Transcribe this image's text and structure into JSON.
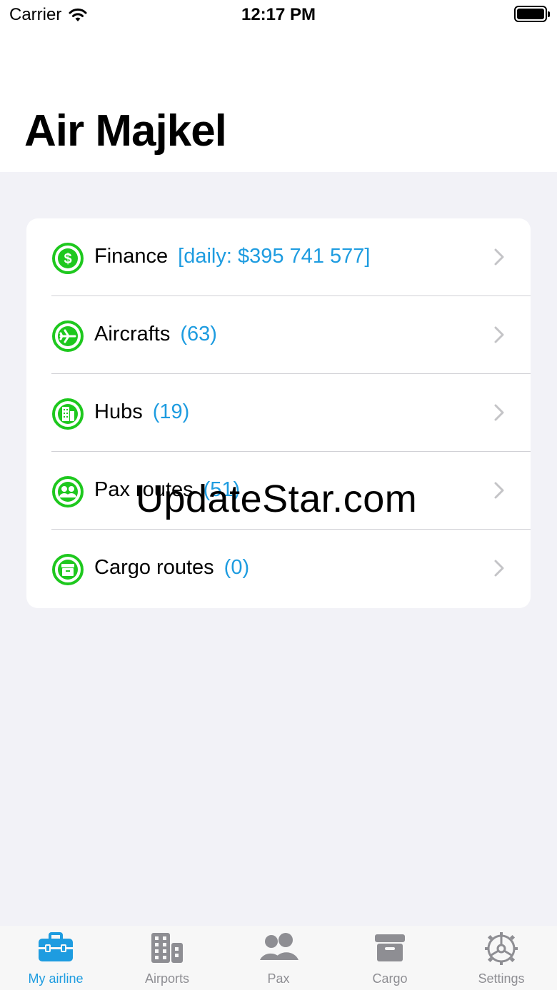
{
  "status_bar": {
    "carrier": "Carrier",
    "time": "12:17 PM"
  },
  "header": {
    "title": "Air Majkel"
  },
  "menu": {
    "items": [
      {
        "label": "Finance",
        "count": "[daily: $395 741 577]",
        "icon": "dollar-circle-icon"
      },
      {
        "label": "Aircrafts",
        "count": "(63)",
        "icon": "airplane-circle-icon"
      },
      {
        "label": "Hubs",
        "count": "(19)",
        "icon": "building-circle-icon"
      },
      {
        "label": "Pax routes",
        "count": "(51)",
        "icon": "people-circle-icon"
      },
      {
        "label": "Cargo routes",
        "count": "(0)",
        "icon": "archivebox-circle-icon"
      }
    ]
  },
  "watermark": "UpdateStar.com",
  "tabbar": {
    "tabs": [
      {
        "label": "My airline",
        "icon": "briefcase-icon",
        "active": true
      },
      {
        "label": "Airports",
        "icon": "building-icon",
        "active": false
      },
      {
        "label": "Pax",
        "icon": "people-icon",
        "active": false
      },
      {
        "label": "Cargo",
        "icon": "archivebox-icon",
        "active": false
      },
      {
        "label": "Settings",
        "icon": "gear-icon",
        "active": false
      }
    ]
  },
  "colors": {
    "accent": "#1e9ce0",
    "icon_green": "#1ec81e",
    "inactive": "#8e8e93",
    "background": "#f2f2f7"
  }
}
